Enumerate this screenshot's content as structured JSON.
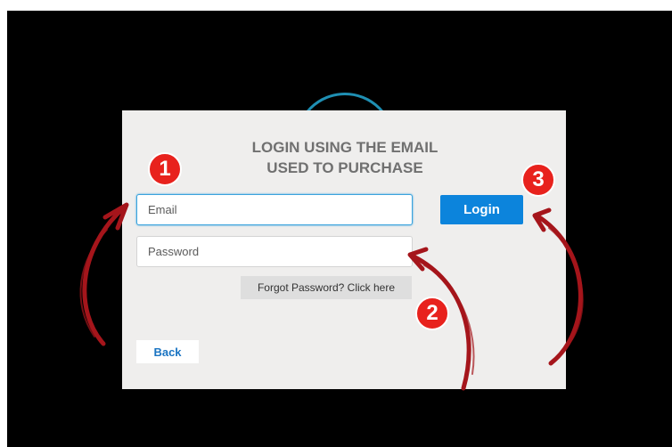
{
  "dialog": {
    "title_line1": "LOGIN USING THE EMAIL",
    "title_line2": "USED TO PURCHASE"
  },
  "form": {
    "email_placeholder": "Email",
    "password_placeholder": "Password",
    "login_label": "Login",
    "forgot_label": "Forgot Password? Click here",
    "back_label": "Back"
  },
  "annotations": {
    "step1": "1",
    "step2": "2",
    "step3": "3"
  },
  "colors": {
    "annotation_red": "#e8221d",
    "arrow_red": "#a5151b",
    "accent_blue": "#0c84dc",
    "ring_blue": "#1f8fb3"
  },
  "icons": [
    "curved-arrow-icon",
    "curved-arrow-icon",
    "curved-arrow-icon"
  ]
}
